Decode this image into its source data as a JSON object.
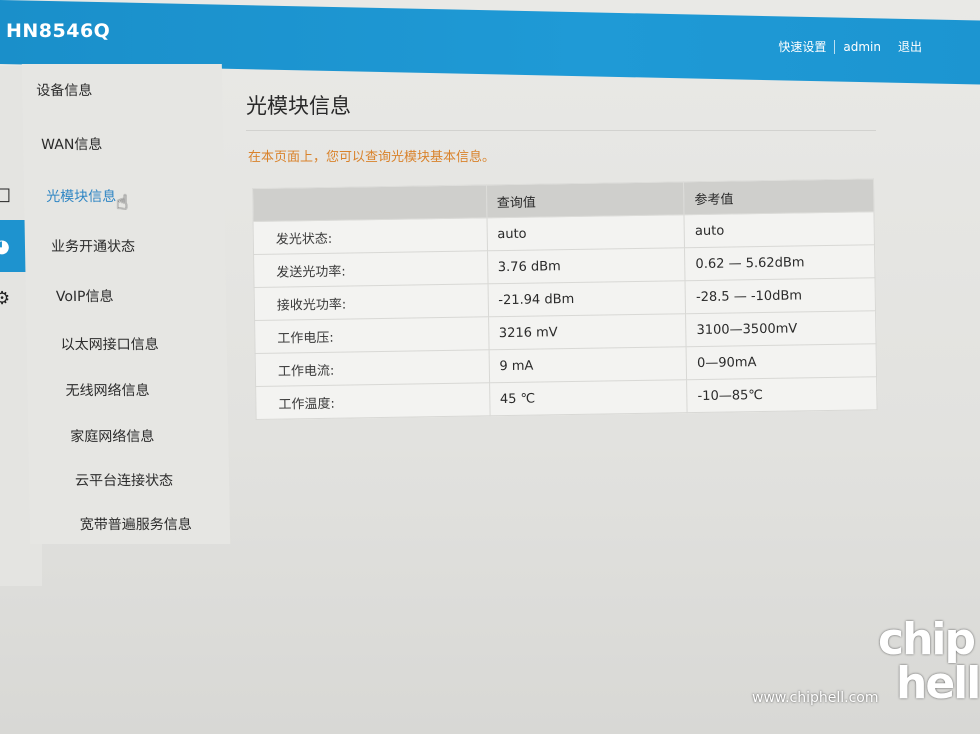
{
  "header": {
    "brand": "HN8546Q",
    "links": [
      "快速设置",
      "admin",
      "退出"
    ]
  },
  "rail": {
    "icons": [
      "square-icon",
      "gauge-icon",
      "gear-icon"
    ]
  },
  "submenu": {
    "items": [
      {
        "label": "设备信息"
      },
      {
        "label": "WAN信息"
      },
      {
        "label": "光模块信息",
        "active": true
      },
      {
        "label": "业务开通状态"
      },
      {
        "label": "VoIP信息"
      },
      {
        "label": "以太网接口信息"
      },
      {
        "label": "无线网络信息"
      },
      {
        "label": "家庭网络信息"
      },
      {
        "label": "云平台连接状态"
      },
      {
        "label": "宽带普遍服务信息"
      }
    ]
  },
  "main": {
    "title": "光模块信息",
    "description": "在本页面上，您可以查询光模块基本信息。",
    "table": {
      "headers": [
        "",
        "查询值",
        "参考值"
      ],
      "rows": [
        [
          "发光状态:",
          "auto",
          "auto"
        ],
        [
          "发送光功率:",
          "3.76 dBm",
          "0.62 — 5.62dBm"
        ],
        [
          "接收光功率:",
          "-21.94 dBm",
          "-28.5 — -10dBm"
        ],
        [
          "工作电压:",
          "3216 mV",
          "3100—3500mV"
        ],
        [
          "工作电流:",
          "9 mA",
          "0—90mA"
        ],
        [
          "工作温度:",
          "45 ℃",
          "-10—85℃"
        ]
      ]
    }
  },
  "watermark": {
    "logo_line1": "chip",
    "logo_line2": "hell",
    "url": "www.chiphell.com"
  },
  "colors": {
    "header_blue": "#1f9ad6",
    "active_link": "#2f86c4",
    "description_orange": "#d9822b"
  }
}
